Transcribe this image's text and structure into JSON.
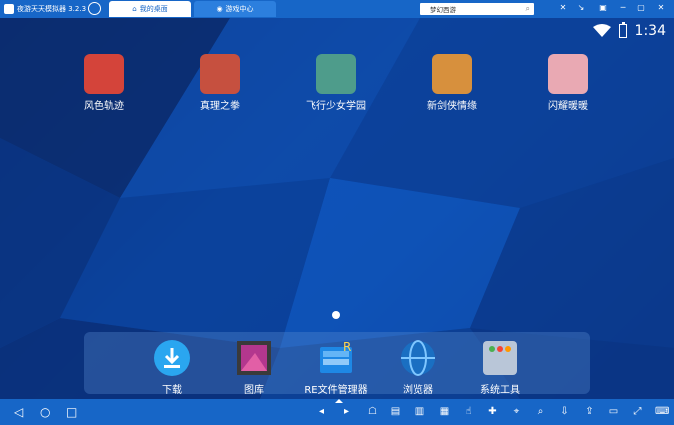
{
  "titlebar": {
    "app_name": "夜游天天模拟器 3.2.3",
    "tabs": [
      {
        "label": "我的桌面",
        "active": true
      },
      {
        "label": "游戏中心",
        "active": false
      }
    ],
    "search_value": "梦幻西游"
  },
  "status": {
    "time": "1:34"
  },
  "apps": [
    {
      "label": "风色轨迹",
      "color": "#d4443a"
    },
    {
      "label": "真理之拳",
      "color": "#c6503f"
    },
    {
      "label": "飞行少女学园",
      "color": "#4e9c8b"
    },
    {
      "label": "新剑侠情缘",
      "color": "#d7903d"
    },
    {
      "label": "闪耀暖暖",
      "color": "#e9a9b3"
    }
  ],
  "dock": [
    {
      "label": "下载"
    },
    {
      "label": "图库"
    },
    {
      "label": "RE文件管理器"
    },
    {
      "label": "浏览器"
    },
    {
      "label": "系统工具"
    }
  ],
  "colors": {
    "accent": "#1766c7",
    "wallpaper_dark": "#0a2f78",
    "wallpaper_mid": "#0d4fb0"
  }
}
